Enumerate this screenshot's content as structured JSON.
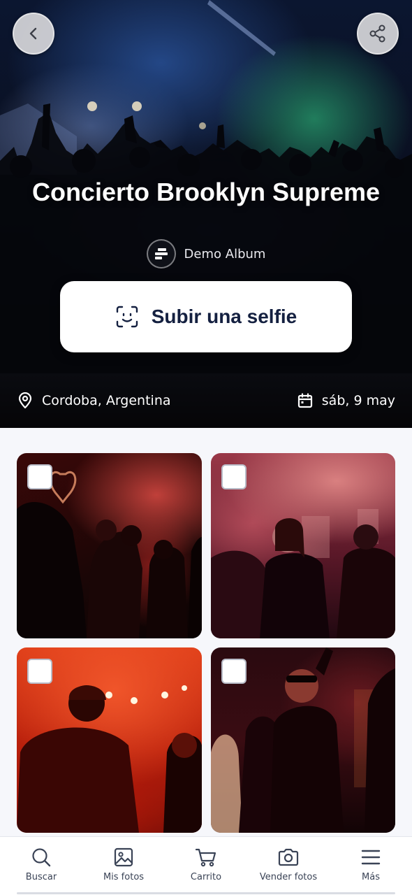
{
  "hero": {
    "title": "Concierto Brooklyn Supreme",
    "album": "Demo Album",
    "selfie_button": "Subir una selfie",
    "location": "Cordoba, Argentina",
    "date": "sáb, 9 may",
    "icons": {
      "back": "chevron-left-icon",
      "share": "share-icon",
      "album": "album-logo-icon",
      "selfie": "face-scan-icon",
      "location": "map-pin-icon",
      "date": "calendar-icon"
    }
  },
  "photos": [
    {
      "id": "photo-1",
      "selected": false
    },
    {
      "id": "photo-2",
      "selected": false
    },
    {
      "id": "photo-3",
      "selected": false
    },
    {
      "id": "photo-4",
      "selected": false
    }
  ],
  "nav": {
    "items": [
      {
        "label": "Buscar",
        "icon": "search-icon"
      },
      {
        "label": "Mis fotos",
        "icon": "image-icon"
      },
      {
        "label": "Carrito",
        "icon": "cart-icon"
      },
      {
        "label": "Vender fotos",
        "icon": "camera-icon"
      },
      {
        "label": "Más",
        "icon": "menu-icon"
      }
    ]
  },
  "colors": {
    "selfie_text": "#142040",
    "nav_text": "#3a4356",
    "page_bg": "#f6f7fb"
  }
}
